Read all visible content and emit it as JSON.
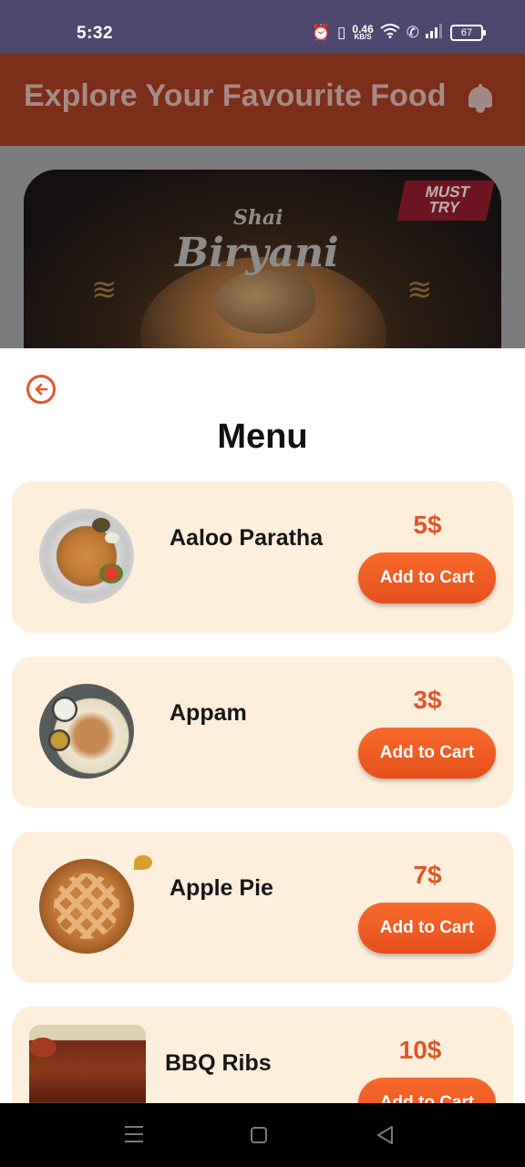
{
  "status_bar": {
    "time": "5:32",
    "net_speed_value": "0.46",
    "net_speed_unit": "KB/S",
    "battery": "67",
    "icons": [
      "alarm-icon",
      "vibrate-icon",
      "wifi-icon",
      "wifi-call-icon",
      "signal-icon",
      "battery-icon"
    ]
  },
  "app_bar": {
    "title": "Explore Your Favourite Food",
    "icon": "bell-icon"
  },
  "banner": {
    "script_top": "Shai",
    "script_main": "Biryani",
    "ribbon_line1": "MUST",
    "ribbon_line2": "TRY"
  },
  "sheet": {
    "back_icon": "arrow-left-circle-icon",
    "title": "Menu",
    "items": [
      {
        "name": "Aaloo Paratha",
        "price": "5$",
        "button": "Add to Cart"
      },
      {
        "name": "Appam",
        "price": "3$",
        "button": "Add to Cart"
      },
      {
        "name": "Apple Pie",
        "price": "7$",
        "button": "Add to Cart"
      },
      {
        "name": "BBQ Ribs",
        "price": "10$",
        "button": "Add to Cart"
      }
    ]
  },
  "nav_bar": {
    "icons": [
      "recent-apps-icon",
      "home-icon",
      "back-icon"
    ]
  },
  "colors": {
    "accent": "#e6552a",
    "card_bg": "#fdefdc",
    "status_bar": "#4f4770"
  }
}
